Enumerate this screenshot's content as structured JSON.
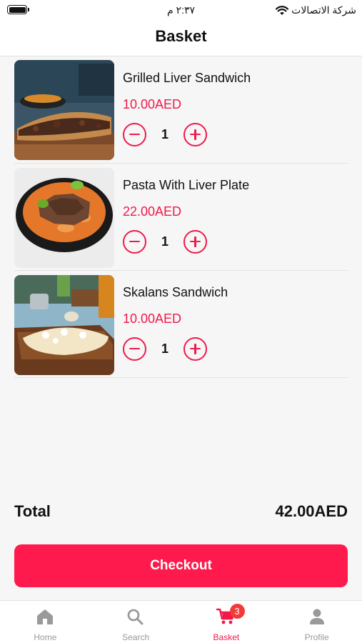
{
  "status_bar": {
    "time": "٢:٣٧ م",
    "carrier": "شركة الاتصالات",
    "icons": [
      "battery-icon",
      "wifi-icon"
    ]
  },
  "header": {
    "title": "Basket"
  },
  "items": [
    {
      "name": "Grilled Liver Sandwich",
      "price": "10.00AED",
      "quantity": "1"
    },
    {
      "name": "Pasta With Liver Plate",
      "price": "22.00AED",
      "quantity": "1"
    },
    {
      "name": "Skalans Sandwich",
      "price": "10.00AED",
      "quantity": "1"
    }
  ],
  "total": {
    "label": "Total",
    "value": "42.00AED"
  },
  "checkout_label": "Checkout",
  "tabbar": {
    "tabs": [
      {
        "label": "Home",
        "icon": "home-icon"
      },
      {
        "label": "Search",
        "icon": "search-icon"
      },
      {
        "label": "Basket",
        "icon": "cart-icon",
        "badge": "3"
      },
      {
        "label": "Profile",
        "icon": "person-icon"
      }
    ],
    "active": "Basket"
  },
  "colors": {
    "accent": "#f0194a",
    "checkout": "#fe1a4c",
    "inactive_tab": "#9a9a9a"
  }
}
